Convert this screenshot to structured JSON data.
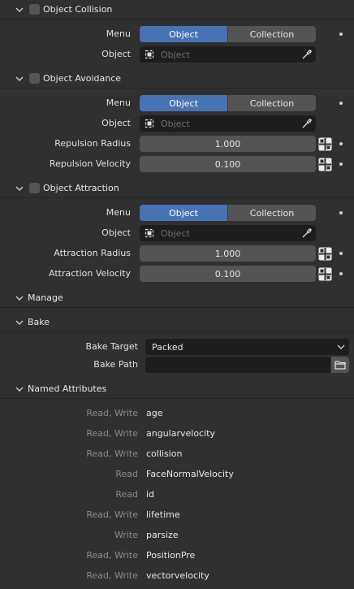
{
  "object_collision": {
    "title": "Object Collision",
    "menu_label": "Menu",
    "menu_options": [
      "Object",
      "Collection"
    ],
    "menu_active": "Object",
    "object_label": "Object",
    "object_placeholder": "Object"
  },
  "object_avoidance": {
    "title": "Object Avoidance",
    "menu_label": "Menu",
    "menu_options": [
      "Object",
      "Collection"
    ],
    "menu_active": "Object",
    "object_label": "Object",
    "object_placeholder": "Object",
    "radius_label": "Repulsion Radius",
    "radius_value": "1.000",
    "velocity_label": "Repulsion Velocity",
    "velocity_value": "0.100"
  },
  "object_attraction": {
    "title": "Object Attraction",
    "menu_label": "Menu",
    "menu_options": [
      "Object",
      "Collection"
    ],
    "menu_active": "Object",
    "object_label": "Object",
    "object_placeholder": "Object",
    "radius_label": "Attraction Radius",
    "radius_value": "1.000",
    "velocity_label": "Attraction Velocity",
    "velocity_value": "0.100"
  },
  "manage": {
    "title": "Manage"
  },
  "bake": {
    "title": "Bake",
    "target_label": "Bake Target",
    "target_value": "Packed",
    "path_label": "Bake Path",
    "path_value": ""
  },
  "named_attributes": {
    "title": "Named Attributes",
    "items": [
      {
        "perm": "Read, Write",
        "name": "age"
      },
      {
        "perm": "Read, Write",
        "name": "angularvelocity"
      },
      {
        "perm": "Read, Write",
        "name": "collision"
      },
      {
        "perm": "Read",
        "name": "FaceNormalVelocity"
      },
      {
        "perm": "Read",
        "name": "id"
      },
      {
        "perm": "Read, Write",
        "name": "lifetime"
      },
      {
        "perm": "Write",
        "name": "parsize"
      },
      {
        "perm": "Read, Write",
        "name": "PositionPre"
      },
      {
        "perm": "Read, Write",
        "name": "vectorvelocity"
      }
    ]
  },
  "colors": {
    "background": "#303030",
    "active_button": "#4772b3",
    "button": "#545454",
    "field": "#1d1d1d"
  }
}
